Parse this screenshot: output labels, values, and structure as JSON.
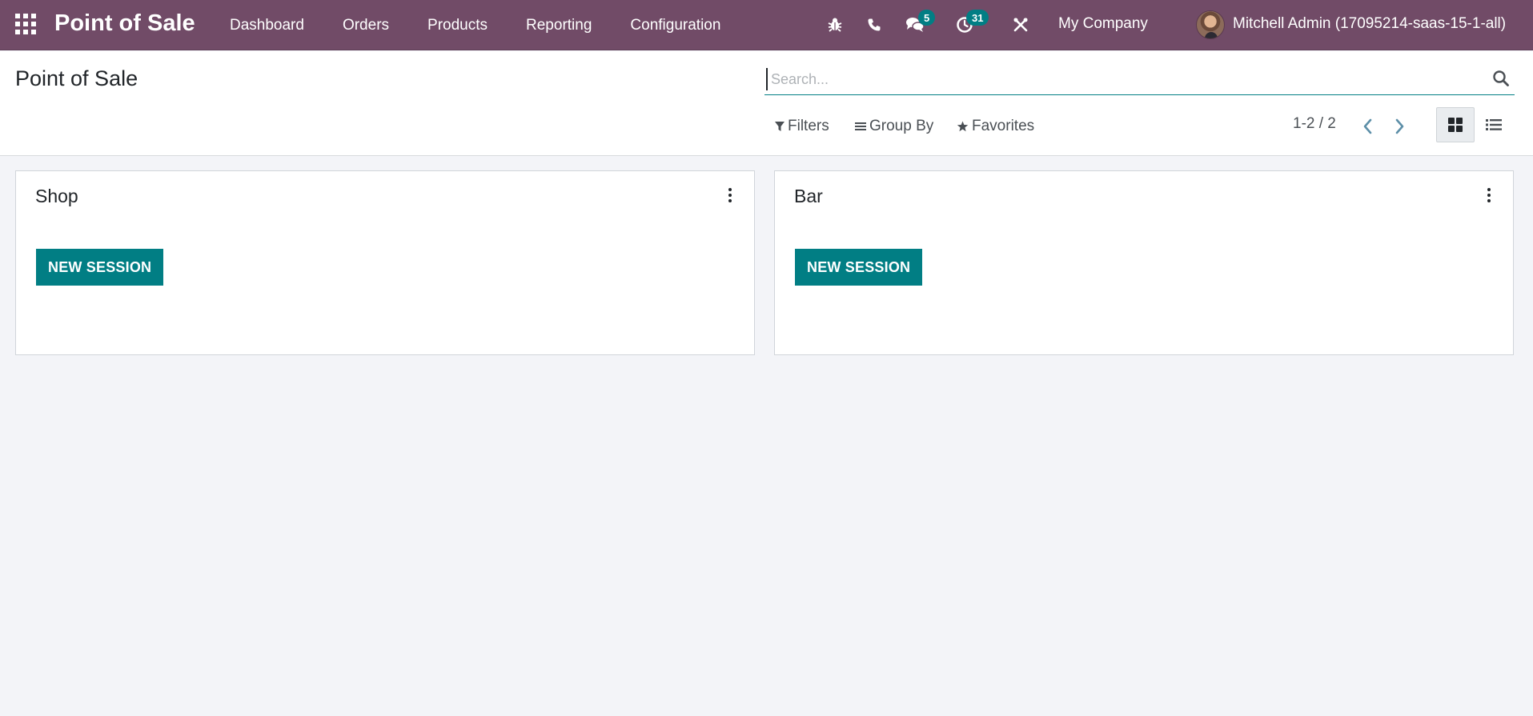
{
  "navbar": {
    "brand": "Point of Sale",
    "menu": [
      "Dashboard",
      "Orders",
      "Products",
      "Reporting",
      "Configuration"
    ],
    "messages_count": "5",
    "activities_count": "31",
    "company": "My Company",
    "user": "Mitchell Admin (17095214-saas-15-1-all)",
    "colors": {
      "navbar_bg": "#714b67",
      "badge_bg": "#017e84"
    }
  },
  "control_panel": {
    "title": "Point of Sale",
    "search_placeholder": "Search...",
    "filters_label": "Filters",
    "group_by_label": "Group By",
    "favorites_label": "Favorites",
    "pager": "1-2 / 2",
    "active_view": "kanban"
  },
  "cards": [
    {
      "title": "Shop",
      "button": "NEW SESSION"
    },
    {
      "title": "Bar",
      "button": "NEW SESSION"
    }
  ],
  "accent_color": "#017e84"
}
